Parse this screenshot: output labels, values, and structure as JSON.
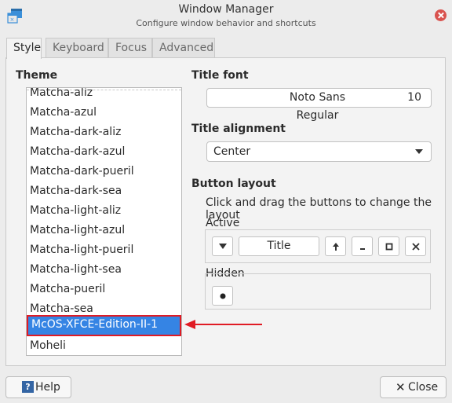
{
  "window": {
    "title": "Window Manager",
    "subtitle": "Configure window behavior and shortcuts"
  },
  "tabs": [
    {
      "label": "Style",
      "active": true
    },
    {
      "label": "Keyboard",
      "active": false
    },
    {
      "label": "Focus",
      "active": false
    },
    {
      "label": "Advanced",
      "active": false
    }
  ],
  "theme": {
    "label": "Theme",
    "items": [
      "Matcha-aliz",
      "Matcha-azul",
      "Matcha-dark-aliz",
      "Matcha-dark-azul",
      "Matcha-dark-pueril",
      "Matcha-dark-sea",
      "Matcha-light-aliz",
      "Matcha-light-azul",
      "Matcha-light-pueril",
      "Matcha-light-sea",
      "Matcha-pueril",
      "Matcha-sea",
      "McOS-XFCE-Edition-II-1",
      "Moheli"
    ],
    "selected": "McOS-XFCE-Edition-II-1"
  },
  "title_font": {
    "label": "Title font",
    "font_name": "Noto Sans Regular",
    "font_size": "10"
  },
  "title_alignment": {
    "label": "Title alignment",
    "value": "Center"
  },
  "button_layout": {
    "label": "Button layout",
    "description": "Click and drag the buttons to change the layout",
    "active_label": "Active",
    "title_button_label": "Title",
    "hidden_label": "Hidden"
  },
  "footer": {
    "help_label": "Help",
    "help_icon_glyph": "?",
    "close_label": "Close"
  },
  "colors": {
    "selection": "#3584e4",
    "highlight": "#e01b24",
    "close_button": "#d9534f"
  }
}
